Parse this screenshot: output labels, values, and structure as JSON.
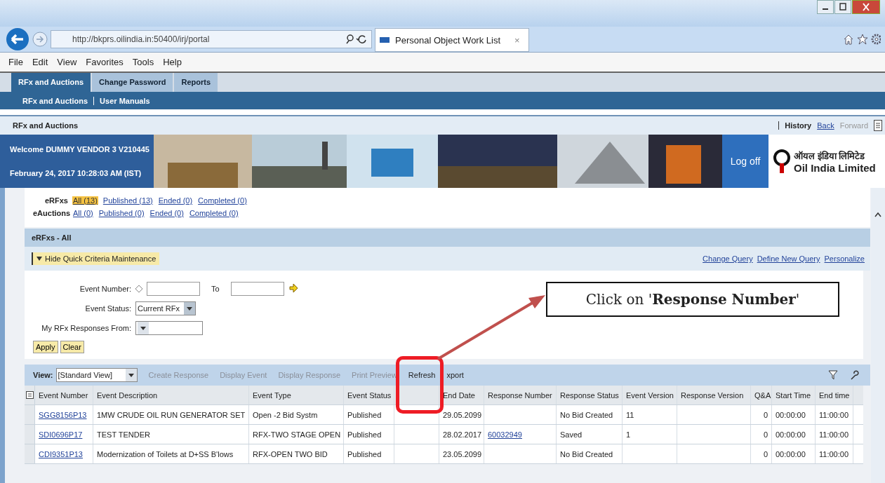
{
  "browser": {
    "url": "http://bkprs.oilindia.in:50400/irj/portal",
    "tab_title": "Personal Object Work List",
    "tab_close": "×"
  },
  "menu_bar": [
    "File",
    "Edit",
    "View",
    "Favorites",
    "Tools",
    "Help"
  ],
  "portal_tabs": [
    {
      "label": "RFx and Auctions",
      "selected": true
    },
    {
      "label": "Change Password",
      "selected": false
    },
    {
      "label": "Reports",
      "selected": false
    }
  ],
  "sub_nav": [
    "RFx and Auctions",
    "User Manuals"
  ],
  "page_header": {
    "title": "RFx and Auctions",
    "history": "History",
    "back": "Back",
    "forward": "Forward"
  },
  "banner": {
    "welcome": "Welcome DUMMY VENDOR 3 V210445",
    "date": "February 24, 2017  10:28:03 AM (IST)",
    "logoff": "Log off",
    "logo_hindi": "ऑयल इंडिया लिमिटेड",
    "logo_english": "Oil India Limited"
  },
  "filters": [
    {
      "label": "eRFxs",
      "links": [
        {
          "text": "All (13)",
          "selected": true
        },
        {
          "text": "Published (13)",
          "selected": false
        },
        {
          "text": "Ended (0)",
          "selected": false
        },
        {
          "text": "Completed (0)",
          "selected": false
        }
      ]
    },
    {
      "label": "eAuctions",
      "links": [
        {
          "text": "All (0)",
          "selected": false
        },
        {
          "text": "Published (0)",
          "selected": false
        },
        {
          "text": "Ended (0)",
          "selected": false
        },
        {
          "text": "Completed (0)",
          "selected": false
        }
      ]
    }
  ],
  "section_title": "eRFxs - All",
  "criteria": {
    "toggle": "Hide Quick Criteria Maintenance",
    "links": [
      "Change Query",
      "Define New Query",
      "Personalize"
    ],
    "event_number_label": "Event Number:",
    "to_label": "To",
    "event_status_label": "Event Status:",
    "event_status_value": "Current RFx",
    "responses_from_label": "My RFx Responses From:",
    "buttons": [
      "Apply",
      "Clear"
    ]
  },
  "toolbar": {
    "view_label": "View:",
    "view_value": "[Standard View]",
    "actions": [
      {
        "label": "Create Response",
        "disabled": true
      },
      {
        "label": "Display Event",
        "disabled": true
      },
      {
        "label": "Display Response",
        "disabled": true
      },
      {
        "label": "Print Preview",
        "disabled": true
      },
      {
        "label": "Refresh",
        "disabled": false
      },
      {
        "label": "xport",
        "disabled": false
      }
    ]
  },
  "table": {
    "columns": [
      {
        "label": "Event Number",
        "kind": "link"
      },
      {
        "label": "Event Description",
        "kind": "text"
      },
      {
        "label": "Event Type",
        "kind": "text"
      },
      {
        "label": "Event Status",
        "kind": "text"
      },
      {
        "kind": "text"
      },
      {
        "label": "End Date",
        "kind": "text"
      },
      {
        "label": "Response Number",
        "kind": "link"
      },
      {
        "label": "Response Status",
        "kind": "text"
      },
      {
        "label": "Event Version",
        "kind": "text"
      },
      {
        "label": "Response Version",
        "kind": "text"
      },
      {
        "label": "Q&A",
        "kind": "number"
      },
      {
        "label": "Start Time",
        "kind": "text"
      },
      {
        "label": "End time",
        "kind": "text"
      }
    ],
    "rows": [
      [
        "SGG8156P13",
        "1MW CRUDE OIL RUN GENERATOR SET",
        "Open -2 Bid Systm",
        "Published",
        "",
        "29.05.2099",
        "",
        "No Bid Created",
        "11",
        "",
        "0",
        "00:00:00",
        "11:00:00"
      ],
      [
        "SDI0696P17",
        "TEST TENDER",
        "RFX-TWO STAGE OPEN",
        "Published",
        "",
        "28.02.2017",
        "60032949",
        "Saved",
        "1",
        "",
        "0",
        "00:00:00",
        "11:00:00"
      ],
      [
        "CDI9351P13",
        "Modernization of Toilets at D+SS B'lows",
        "RFX-OPEN TWO BID",
        "Published",
        "",
        "23.05.2099",
        "",
        "No Bid Created",
        "",
        "",
        "0",
        "00:00:00",
        "11:00:00"
      ]
    ]
  },
  "annotation": {
    "text": "Click on '**Response Number**'"
  }
}
